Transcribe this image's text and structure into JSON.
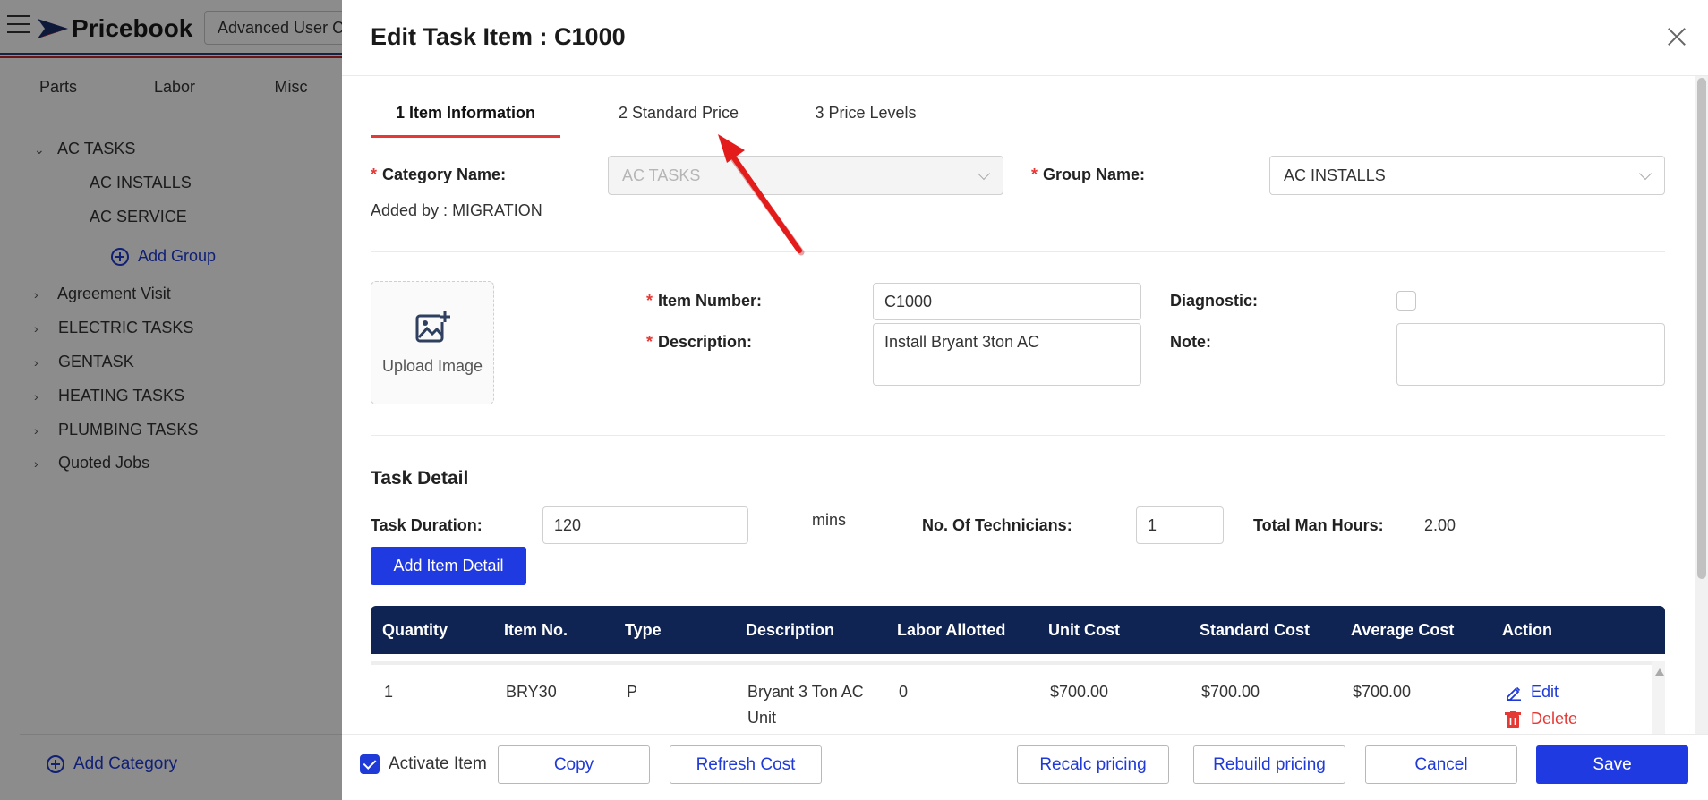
{
  "app": {
    "logo_text": "Pricebook",
    "user_select": "Advanced User C",
    "nav_tabs": [
      "Parts",
      "Labor",
      "Misc"
    ],
    "tree": {
      "open_category": "AC TASKS",
      "open_groups": [
        "AC INSTALLS",
        "AC SERVICE"
      ],
      "add_group": "Add Group",
      "categories": [
        "Agreement Visit",
        "ELECTRIC TASKS",
        "GENTASK",
        "HEATING TASKS",
        "PLUMBING TASKS",
        "Quoted Jobs"
      ]
    },
    "add_category": "Add Category"
  },
  "modal": {
    "title": "Edit Task Item : C1000",
    "steps": [
      "1 Item Information",
      "2 Standard Price",
      "3 Price Levels"
    ],
    "category_label": "Category Name:",
    "category_value": "AC TASKS",
    "group_label": "Group Name:",
    "group_value": "AC INSTALLS",
    "added_by": "Added by : MIGRATION",
    "upload_label": "Upload Image",
    "item_number_label": "Item Number:",
    "item_number_value": "C1000",
    "description_label": "Description:",
    "description_value": "Install Bryant 3ton AC",
    "diagnostic_label": "Diagnostic:",
    "note_label": "Note:",
    "note_value": "",
    "task_detail_title": "Task Detail",
    "task_duration_label": "Task Duration:",
    "task_duration_value": "120",
    "mins_label": "mins",
    "technicians_label": "No. Of Technicians:",
    "technicians_value": "1",
    "man_hours_label": "Total Man Hours:",
    "man_hours_value": "2.00",
    "add_item_detail": "Add Item Detail",
    "table": {
      "headers": [
        "Quantity",
        "Item No.",
        "Type",
        "Description",
        "Labor Allotted",
        "Unit Cost",
        "Standard Cost",
        "Average Cost",
        "Action"
      ],
      "rows": [
        {
          "quantity": "1",
          "item_no": "BRY30",
          "type": "P",
          "description": "Bryant 3 Ton AC Unit",
          "labor": "0",
          "unit_cost": "$700.00",
          "standard_cost": "$700.00",
          "average_cost": "$700.00",
          "edit": "Edit",
          "delete": "Delete"
        }
      ]
    },
    "footer": {
      "activate_label": "Activate Item",
      "copy": "Copy",
      "refresh_cost": "Refresh Cost",
      "recalc_pricing": "Recalc pricing",
      "rebuild_pricing": "Rebuild pricing",
      "cancel": "Cancel",
      "save": "Save"
    }
  },
  "colors": {
    "primary": "#1f3ae0",
    "table_header": "#0f2453",
    "required": "#e53935",
    "annotation_arrow": "#e31b1b"
  },
  "icons": [
    "menu-icon",
    "logo-plane-icon",
    "chevron-down-icon",
    "chevron-right-icon",
    "plus-circle-icon",
    "close-icon",
    "image-upload-icon",
    "edit-icon",
    "trash-icon",
    "check-icon"
  ]
}
